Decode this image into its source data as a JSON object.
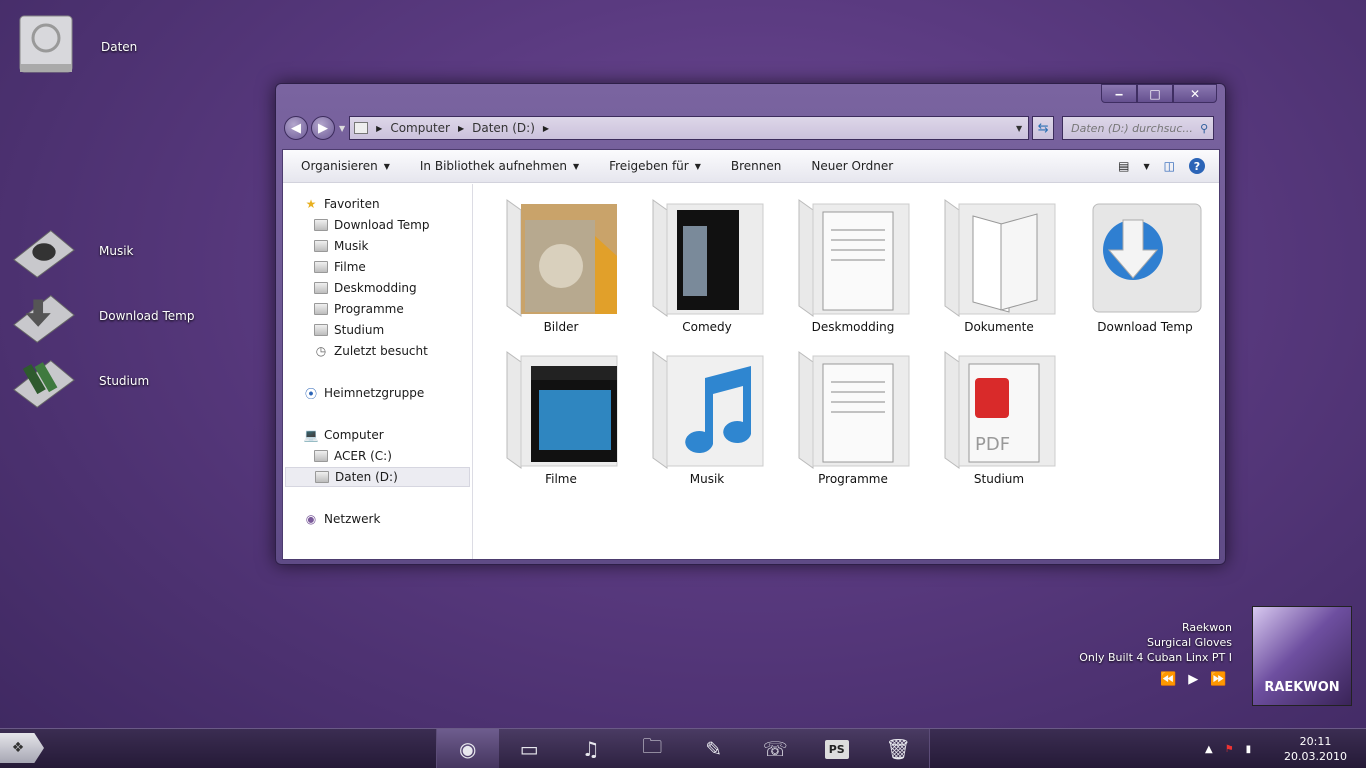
{
  "desktop": {
    "icons": [
      {
        "label": "Daten",
        "icon": "hard-drive-icon"
      },
      {
        "label": "Musik",
        "icon": "speaker-icon"
      },
      {
        "label": "Download Temp",
        "icon": "download-arrow-icon"
      },
      {
        "label": "Studium",
        "icon": "books-icon"
      }
    ]
  },
  "window": {
    "caption": {
      "minimize": "‒",
      "maximize": "□",
      "close": "✕"
    },
    "address": {
      "crumbs": [
        "Computer",
        "Daten (D:)"
      ]
    },
    "search_placeholder": "Daten (D:) durchsuc...",
    "toolbar": {
      "organize": "Organisieren",
      "library": "In Bibliothek aufnehmen",
      "share": "Freigeben für",
      "burn": "Brennen",
      "new_folder": "Neuer Ordner"
    },
    "sidebar": {
      "favorites": "Favoriten",
      "fav_items": [
        "Download Temp",
        "Musik",
        "Filme",
        "Deskmodding",
        "Programme",
        "Studium",
        "Zuletzt besucht"
      ],
      "homegroup": "Heimnetzgruppe",
      "computer": "Computer",
      "drives": [
        "ACER (C:)",
        "Daten (D:)"
      ],
      "network": "Netzwerk"
    },
    "files": [
      "Bilder",
      "Comedy",
      "Deskmodding",
      "Dokumente",
      "Download Temp",
      "Filme",
      "Musik",
      "Programme",
      "Studium"
    ]
  },
  "media": {
    "artist": "Raekwon",
    "track": "Surgical Gloves",
    "album": "Only Built 4 Cuban Linx PT I",
    "cover_text": "RAEKWON"
  },
  "taskbar": {
    "time": "20:11",
    "date": "20.03.2010",
    "ps_label": "PS"
  },
  "colors": {
    "accent": "#5a3a80",
    "window_frame": "#6f5a96"
  }
}
